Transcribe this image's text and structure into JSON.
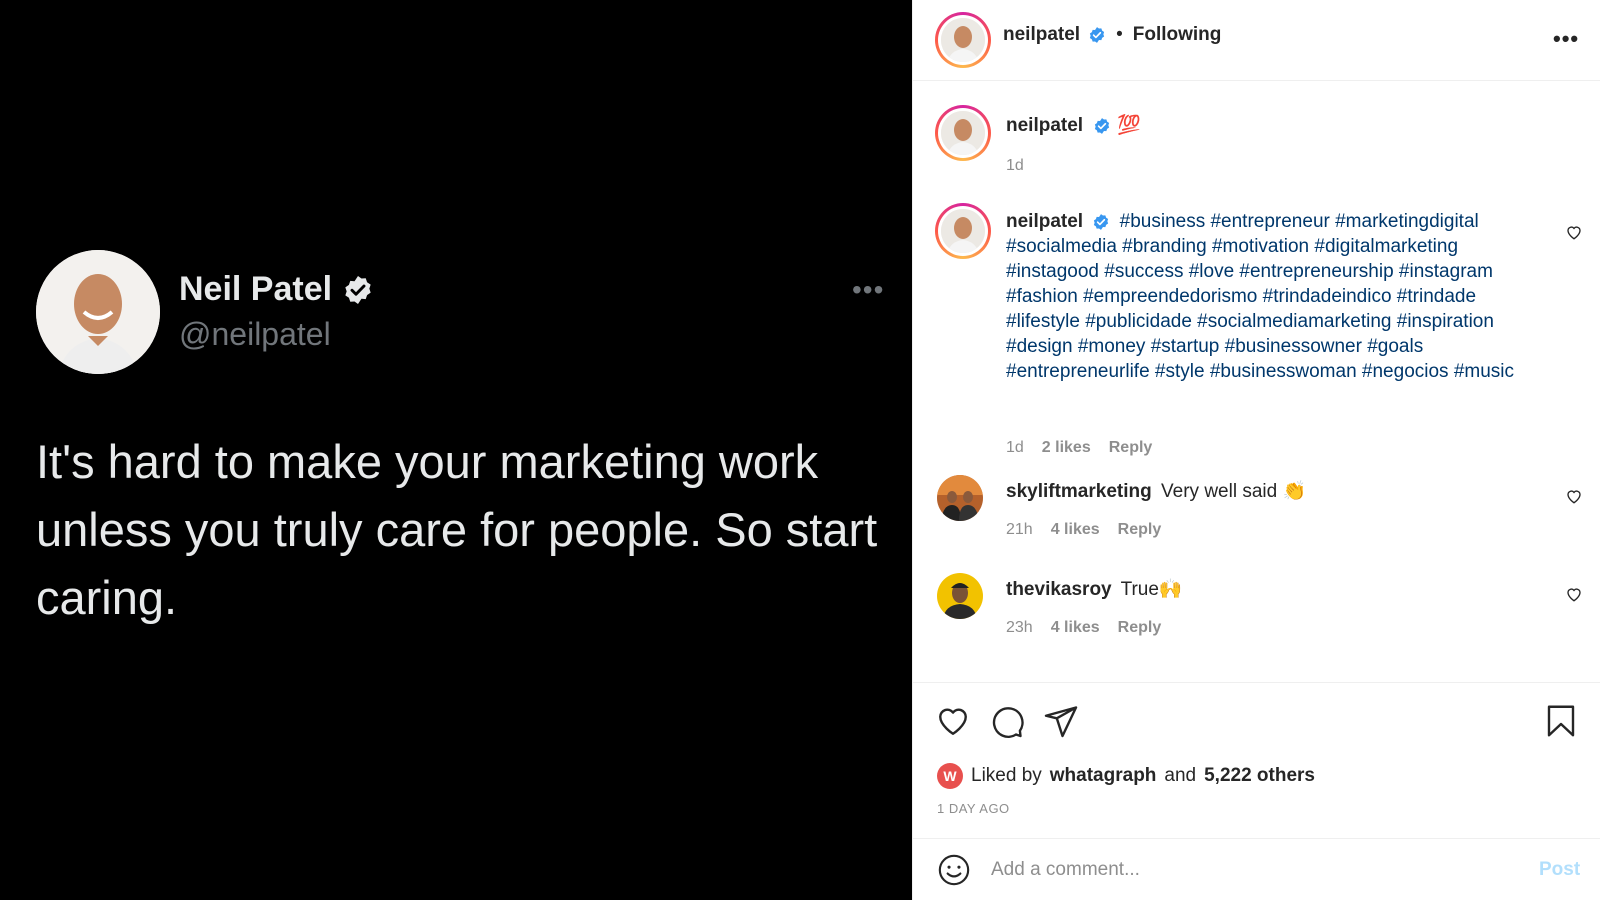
{
  "post_image": {
    "tweet_name": "Neil Patel",
    "tweet_handle": "@neilpatel",
    "tweet_more": "•••",
    "tweet_text": "It's hard to make your marketing work unless you truly care for people. So start caring."
  },
  "header": {
    "username": "neilpatel",
    "separator": "•",
    "follow_status": "Following",
    "more": "•••"
  },
  "caption": {
    "username": "neilpatel",
    "text": "💯",
    "time": "1d"
  },
  "comments": [
    {
      "username": "neilpatel",
      "text": "#business #entrepreneur #marketingdigital #socialmedia #branding #motivation #digitalmarketing #instagood #success #love #entrepreneurship #instagram #fashion #empreendedorismo #trindadeindico #trindade #lifestyle #publicidade #socialmediamarketing #inspiration #design #money #startup #businessowner #goals #entrepreneurlife #style #businesswoman #negocios #music",
      "time": "1d",
      "likes": "2 likes",
      "reply": "Reply"
    },
    {
      "username": "skyliftmarketing",
      "text": "Very well said 👏",
      "time": "21h",
      "likes": "4 likes",
      "reply": "Reply"
    },
    {
      "username": "thevikasroy",
      "text": "True🙌",
      "time": "23h",
      "likes": "4 likes",
      "reply": "Reply"
    }
  ],
  "likes": {
    "prefix": "Liked by",
    "user": "whatagraph",
    "conjunction": "and",
    "others": "5,222 others",
    "avatar_letter": "W"
  },
  "timestamp": "1 DAY AGO",
  "add_comment": {
    "placeholder": "Add a comment...",
    "post_label": "Post"
  },
  "colors": {
    "verified": "#3897f0",
    "hashtag": "#00376b",
    "post_disabled": "#b2dffc"
  }
}
